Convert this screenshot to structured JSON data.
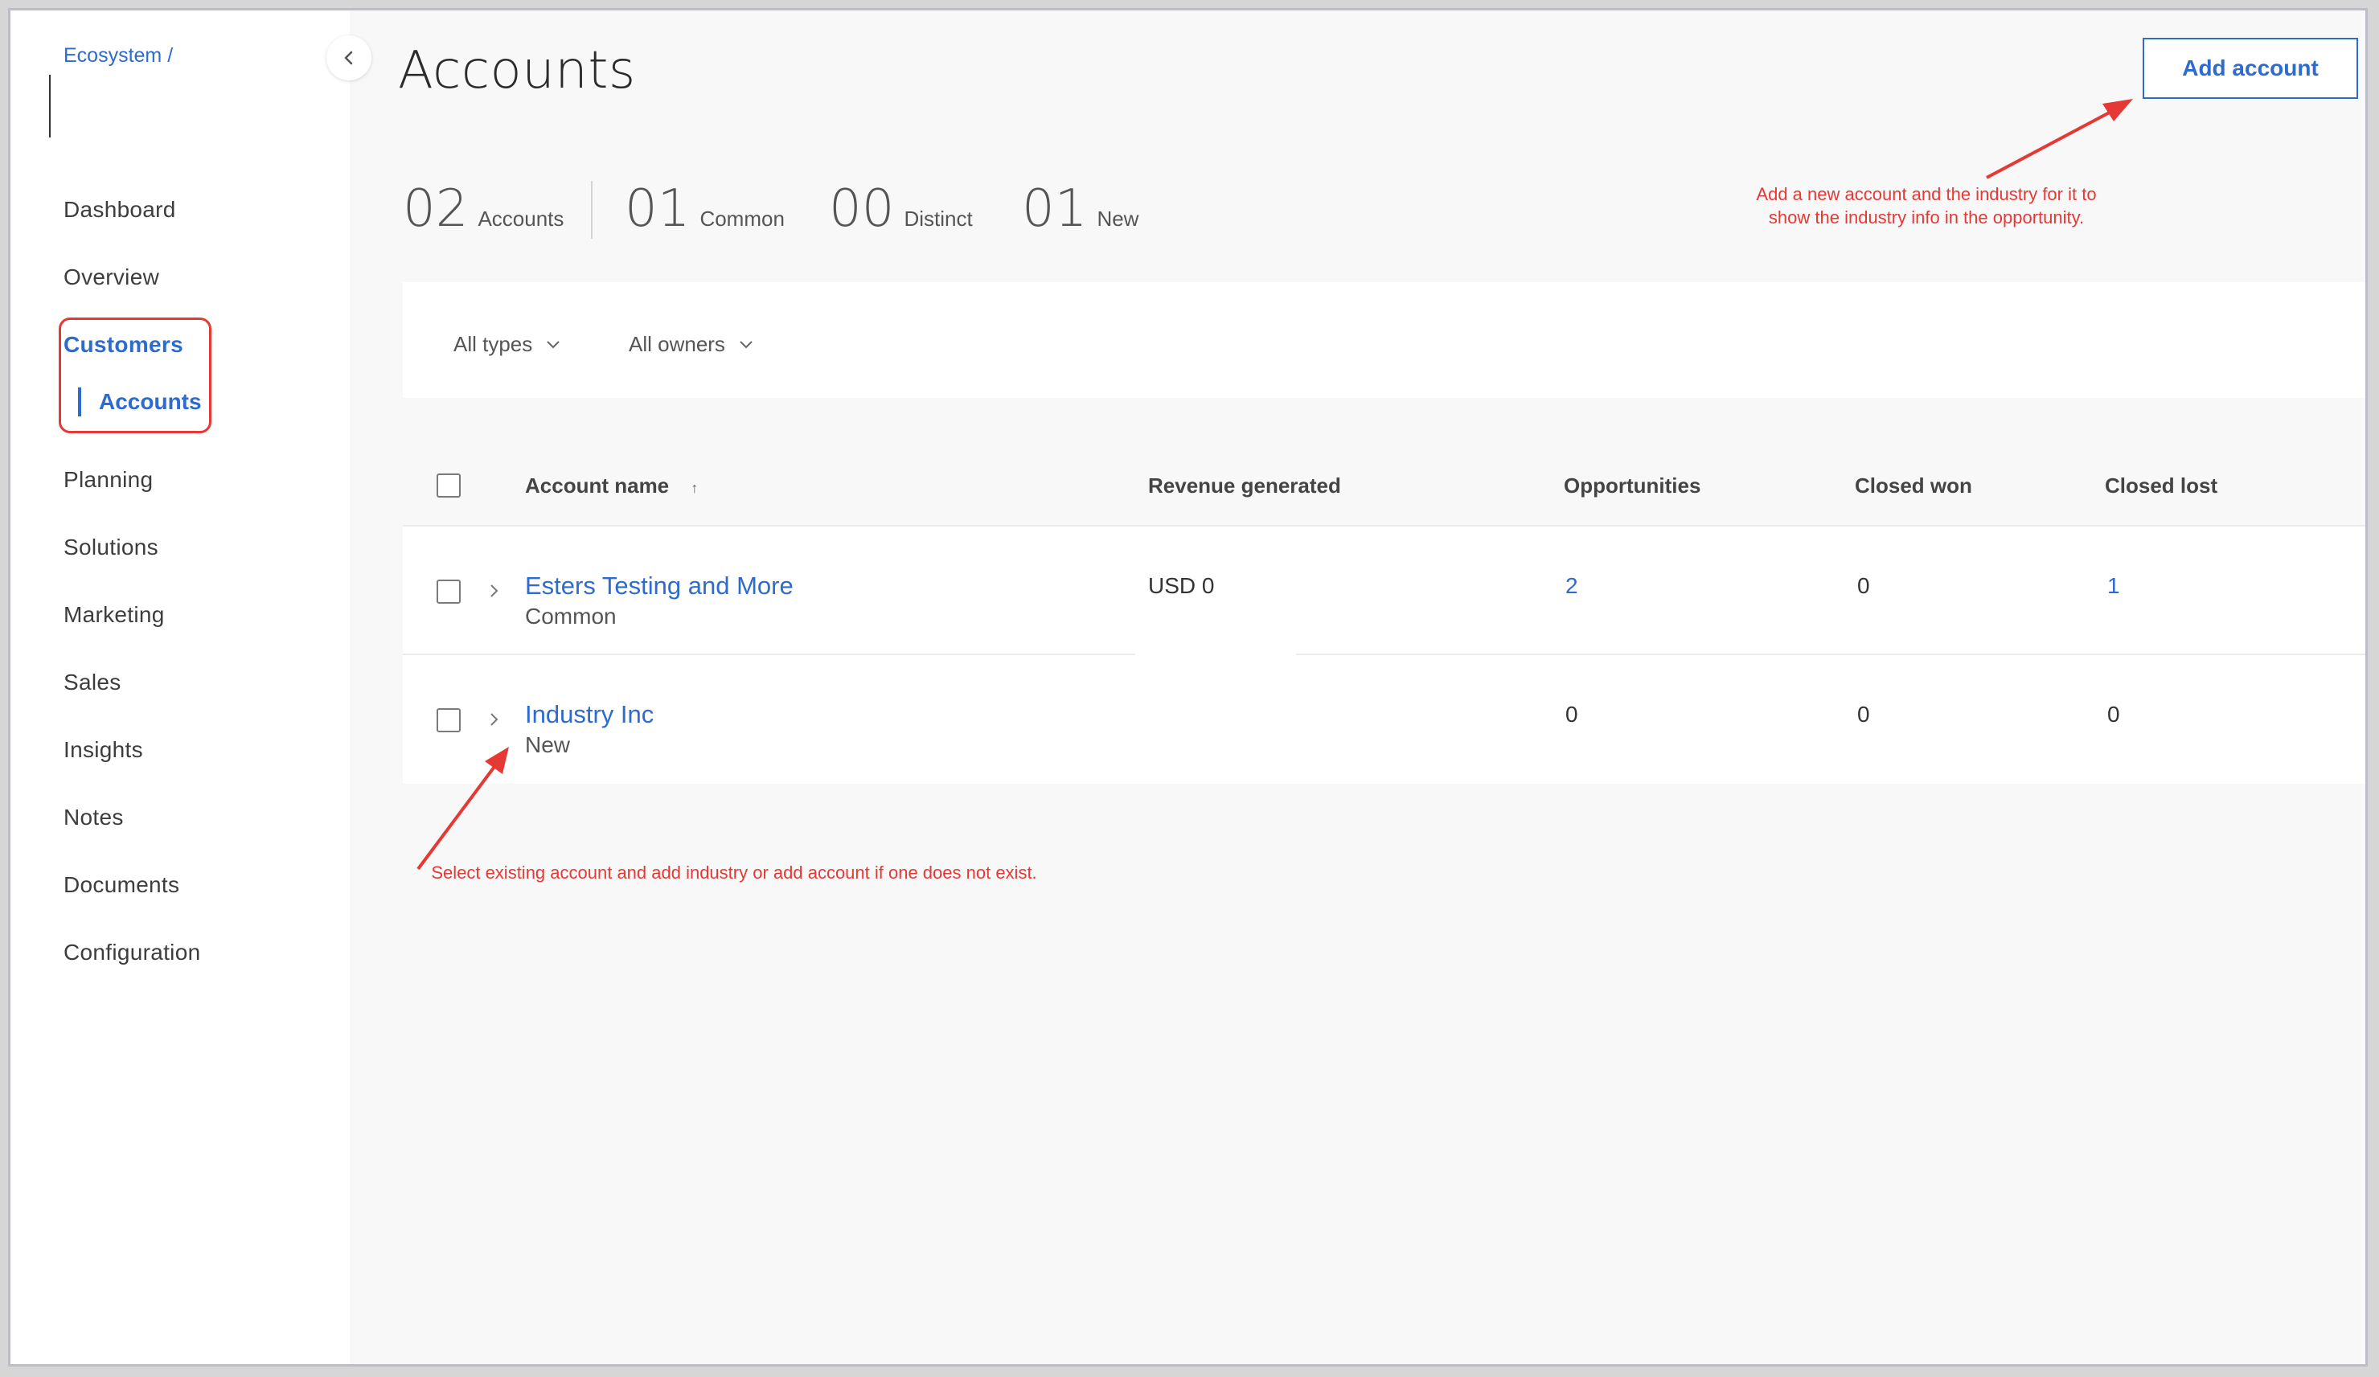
{
  "breadcrumb": "Ecosystem /",
  "sidebar": {
    "items": [
      "Dashboard",
      "Overview",
      "Customers",
      "Accounts",
      "Planning",
      "Solutions",
      "Marketing",
      "Sales",
      "Insights",
      "Notes",
      "Documents",
      "Configuration"
    ]
  },
  "page": {
    "title": "Accounts",
    "add_button": "Add account"
  },
  "stats": [
    {
      "value": "02",
      "label": "Accounts"
    },
    {
      "value": "01",
      "label": "Common"
    },
    {
      "value": "00",
      "label": "Distinct"
    },
    {
      "value": "01",
      "label": "New"
    }
  ],
  "filters": {
    "types": "All types",
    "owners": "All owners"
  },
  "table": {
    "headers": [
      "Account name",
      "Revenue generated",
      "Opportunities",
      "Closed won",
      "Closed lost"
    ],
    "sort_indicator": "↑",
    "rows": [
      {
        "name": "Esters Testing and More",
        "type": "Common",
        "revenue": "USD 0",
        "opportunities": "2",
        "closed_won": "0",
        "closed_lost": "1"
      },
      {
        "name": "Industry Inc",
        "type": "New",
        "revenue": "",
        "opportunities": "0",
        "closed_won": "0",
        "closed_lost": "0"
      }
    ]
  },
  "annotations": {
    "top": "Add a new account and the industry for it to show the industry info in the opportunity.",
    "bottom": "Select existing account and add industry or add account if one does not exist."
  },
  "colors": {
    "accent": "#2d6bcf",
    "annotation": "#e53935"
  }
}
